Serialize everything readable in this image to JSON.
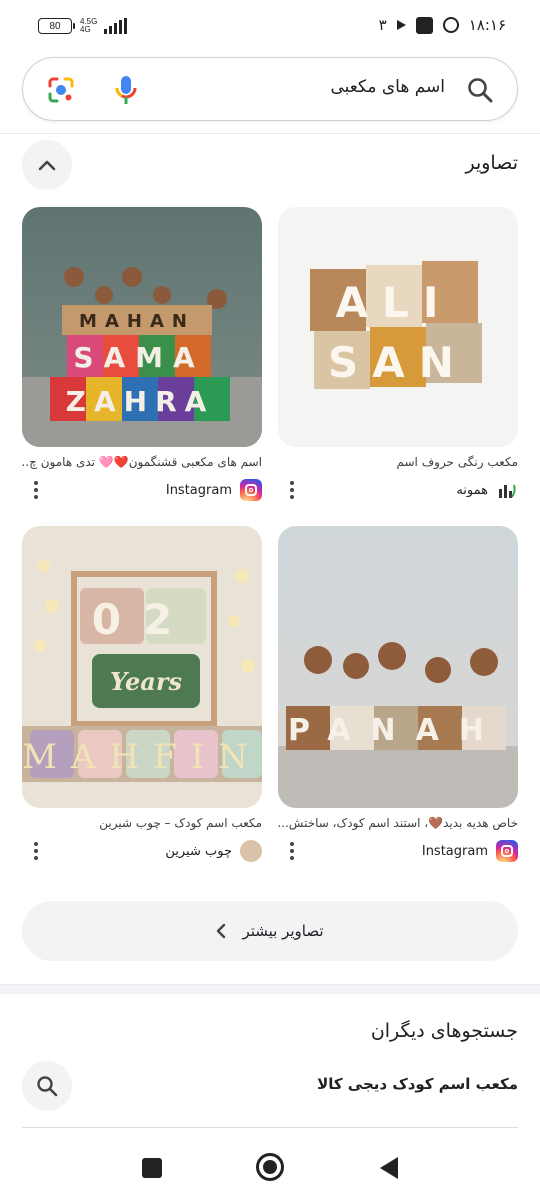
{
  "status_bar": {
    "battery": "80",
    "network_top": "4.5G",
    "network_bottom": "4G",
    "notification_count": "۳",
    "time": "۱۸:۱۶"
  },
  "search": {
    "query": "اسم های مکعبی"
  },
  "images_section": {
    "title": "تصاویر",
    "cards": [
      {
        "caption": "اسم های مکعبی قشنگمون❤️🩷 تدی هامون چ...",
        "source": "Instagram",
        "image_words": [
          "MAHAN",
          "SAMA",
          "ZAHRA"
        ]
      },
      {
        "caption": "مکعب رنگی حروف اسم",
        "source": "همونه",
        "image_words": [
          "ALI",
          "SAN"
        ]
      },
      {
        "caption": "مکعب اسم کودک – چوب شیرین",
        "source": "چوب شیرین",
        "image_words": [
          "02",
          "Years",
          "MAHFIN"
        ]
      },
      {
        "caption": "خاص هدیه بدید🤎، استند اسم کودک، ساختش...",
        "source": "Instagram",
        "image_words": [
          "PANAH"
        ]
      }
    ],
    "more_label": "تصاویر بیشتر"
  },
  "other_searches": {
    "title": "جستجوهای دیگران",
    "items": [
      {
        "label": "مکعب اسم کودک دیجی کالا"
      }
    ]
  },
  "colors": {
    "google_blue": "#4285F4",
    "google_red": "#EA4335",
    "google_yellow": "#FBBC05",
    "google_green": "#34A853"
  }
}
